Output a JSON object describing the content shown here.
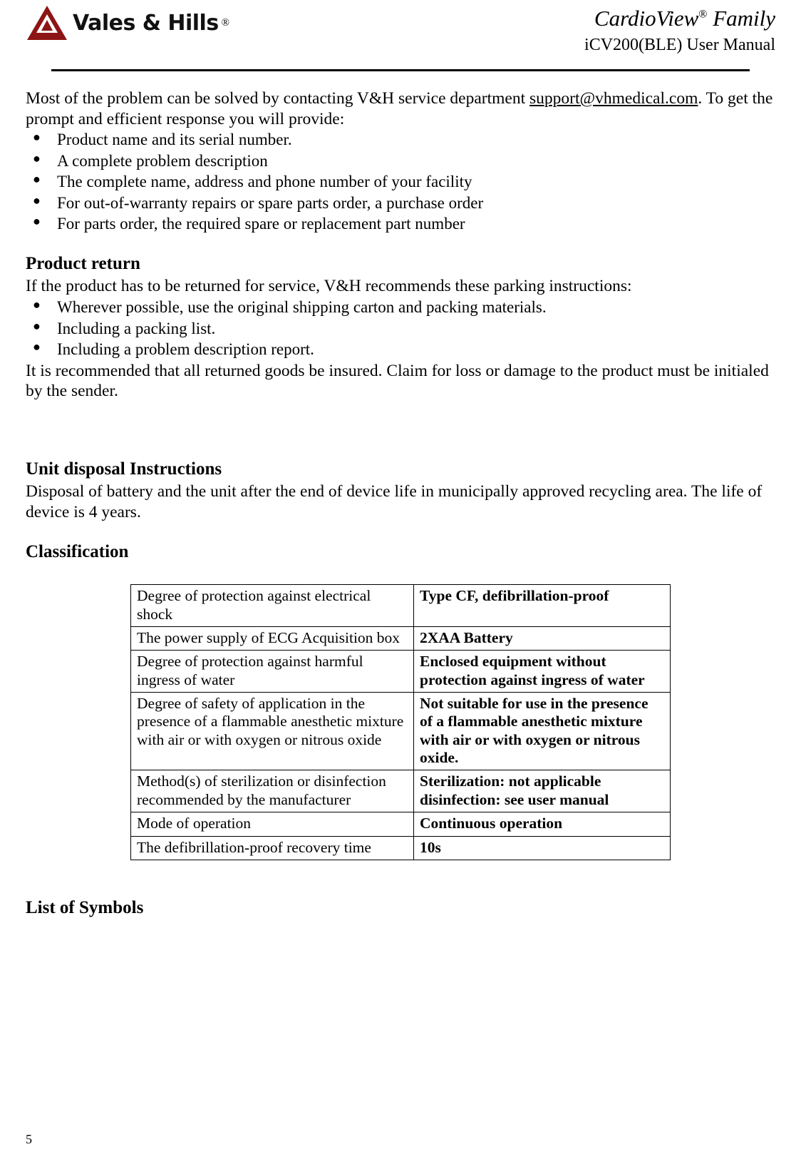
{
  "header": {
    "logo_text": "Vales & Hills",
    "logo_reg": "®",
    "title_line1_pre": "Cardio",
    "title_line1_mid": "View",
    "title_line1_sup": "®",
    "title_line1_post": " Family",
    "title_line2": "iCV200(BLE) User Manual"
  },
  "body": {
    "intro_before_link": "Most of the problem can be solved by contacting V&H service department ",
    "intro_link": "support@vhmedical.com",
    "intro_after_link": ". To get the prompt and efficient response you will provide:",
    "intro_bullets": [
      "Product name and its serial number.",
      "A complete problem description",
      "The complete name, address and phone number of your facility",
      "For out-of-warranty repairs or spare parts order, a purchase order",
      "For parts order, the required spare or replacement part number"
    ],
    "product_return_heading": "Product return",
    "product_return_intro": "If the product has to be returned for service, V&H recommends these parking instructions:",
    "product_return_bullets": [
      "Wherever possible, use the original shipping carton and packing materials.",
      "Including a packing list.",
      "Including a problem description report."
    ],
    "product_return_note": "It is recommended that all returned goods be insured. Claim for loss or damage to the product must be initialed by the sender.",
    "disposal_heading": "Unit disposal Instructions",
    "disposal_text": "Disposal of battery and the unit after the end of device life in municipally approved recycling area. The life of device is 4 years.",
    "classification_heading": "Classification",
    "symbols_heading": "List of Symbols"
  },
  "classification_table": {
    "rows": [
      {
        "label": "Degree of protection against electrical shock",
        "value": "Type CF, defibrillation-proof"
      },
      {
        "label": "The power supply of ECG Acquisition box",
        "value": "2XAA Battery"
      },
      {
        "label": "Degree of protection against harmful ingress of water",
        "value": "Enclosed equipment without protection against ingress of water"
      },
      {
        "label": "Degree of safety of application in the presence of a flammable anesthetic mixture with air or with oxygen or nitrous oxide",
        "value": "Not suitable for use in the presence of a flammable anesthetic mixture with air or with oxygen or nitrous oxide."
      },
      {
        "label": "Method(s) of sterilization or disinfection recommended by the manufacturer",
        "value": "Sterilization: not applicable disinfection: see user manual"
      },
      {
        "label": "Mode of operation",
        "value": "Continuous operation"
      },
      {
        "label": "The defibrillation-proof recovery time",
        "value": "10s"
      }
    ]
  },
  "footer": {
    "page_number": "5"
  }
}
